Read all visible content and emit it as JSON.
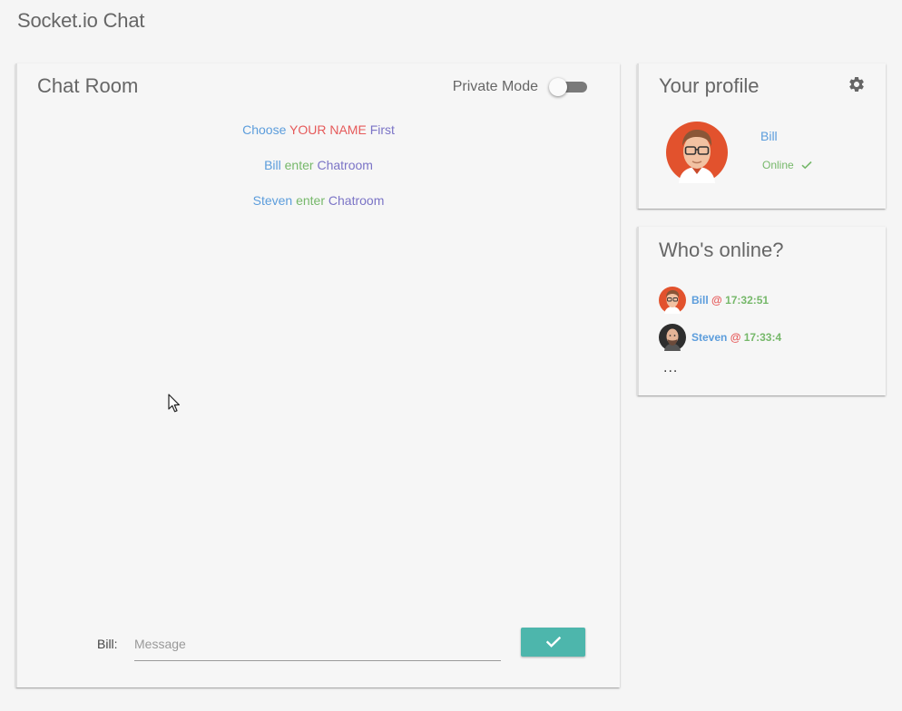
{
  "app": {
    "title": "Socket.io Chat"
  },
  "chat": {
    "title": "Chat Room",
    "private_mode_label": "Private Mode",
    "private_mode_on": false,
    "messages": [
      {
        "parts": [
          {
            "text": "Choose",
            "color": "blue"
          },
          {
            "text": "YOUR NAME",
            "color": "red"
          },
          {
            "text": "First",
            "color": "purple"
          }
        ]
      },
      {
        "parts": [
          {
            "text": "Bill",
            "color": "blue"
          },
          {
            "text": "enter",
            "color": "green"
          },
          {
            "text": "Chatroom",
            "color": "purple"
          }
        ]
      },
      {
        "parts": [
          {
            "text": "Steven",
            "color": "blue"
          },
          {
            "text": "enter",
            "color": "green"
          },
          {
            "text": "Chatroom",
            "color": "purple"
          }
        ]
      }
    ],
    "input_label": "Bill:",
    "input_placeholder": "Message",
    "input_value": "",
    "send_icon": "check-icon"
  },
  "profile": {
    "title": "Your profile",
    "settings_icon": "gear-icon",
    "name": "Bill",
    "status": "Online",
    "status_icon": "check-icon"
  },
  "online": {
    "title": "Who's online?",
    "users": [
      {
        "name": "Bill",
        "at": "@",
        "time": "17:32:51"
      },
      {
        "name": "Steven",
        "at": "@",
        "time": "17:33:4"
      }
    ],
    "more": "..."
  },
  "colors": {
    "blue": "#5c9ddc",
    "red": "#e65a5a",
    "purple": "#7b74c6",
    "green": "#76b86a",
    "accent": "#4db6ac",
    "background": "#f5f5f5"
  }
}
